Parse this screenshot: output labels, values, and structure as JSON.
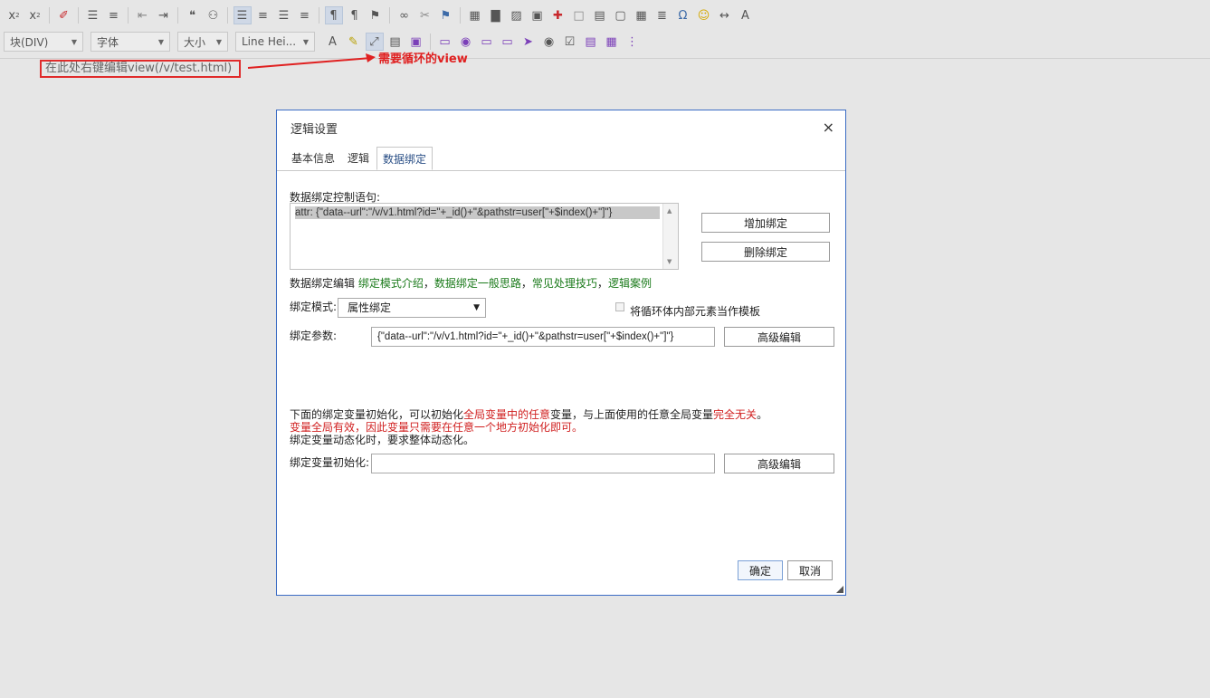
{
  "toolbar": {
    "row1_icons": [
      "subscript-icon",
      "superscript-icon",
      "clear-format-icon",
      "ordered-list-icon",
      "unordered-list-icon",
      "outdent-icon",
      "indent-icon",
      "blockquote-icon",
      "find-icon",
      "align-left-icon",
      "align-center-icon",
      "align-right-icon",
      "justify-icon",
      "ltr-icon",
      "rtl-icon",
      "translate-icon",
      "link-icon",
      "unlink-icon",
      "anchor-icon",
      "insert-frame-icon",
      "chart-icon",
      "image-icon",
      "video-icon",
      "special-icon",
      "template-icon",
      "code-icon",
      "page-icon",
      "table-icon",
      "font-format-icon",
      "omega-icon",
      "emoji-icon",
      "horizontal-rule-icon",
      "spell-check-icon"
    ],
    "block_combo": "块(DIV)",
    "font_combo": "字体",
    "size_combo": "大小",
    "lineheight_combo": "Line Hei..."
  },
  "editor": {
    "text": "在此处右键编辑view(/v/test.html)"
  },
  "annotation": {
    "label": "需要循环的view"
  },
  "dialog": {
    "title": "逻辑设置",
    "close": "×",
    "tabs": [
      {
        "label": "基本信息"
      },
      {
        "label": "逻辑"
      },
      {
        "label": "数据绑定"
      }
    ],
    "binding_statement_label": "数据绑定控制语句:",
    "binding_statement_value": "attr: {\"data--url\":\"/v/v1.html?id=\"+_id()+\"&pathstr=user[\"+$index()+\"]\"}",
    "add_binding_button": "增加绑定",
    "delete_binding_button": "删除绑定",
    "binding_edit_prefix": "数据绑定编辑",
    "links": [
      "绑定模式介绍",
      "数据绑定一般思路",
      "常见处理技巧",
      "逻辑案例"
    ],
    "link_separator": "，",
    "mode_label": "绑定模式:",
    "mode_value": "属性绑定",
    "template_checkbox_label": "将循环体内部元素当作模板",
    "params_label": "绑定参数:",
    "params_value": "{\"data--url\":\"/v/v1.html?id=\"+_id()+\"&pathstr=user[\"+$index()+\"]\"}",
    "advanced_edit_button": "高级编辑",
    "note1_a": "下面的绑定变量初始化，可以初始化",
    "note1_b": "全局变量中的任意",
    "note1_c": "变量，与上面使用的任意全局变量",
    "note1_d": "完全无关",
    "note1_e": "。",
    "note2": "变量全局有效，因此变量只需要在任意一个地方初始化即可。",
    "note3": "绑定变量动态化时，要求整体动态化。",
    "init_label": "绑定变量初始化:",
    "init_value": "",
    "advanced_edit_button2": "高级编辑",
    "ok_button": "确定",
    "cancel_button": "取消"
  }
}
